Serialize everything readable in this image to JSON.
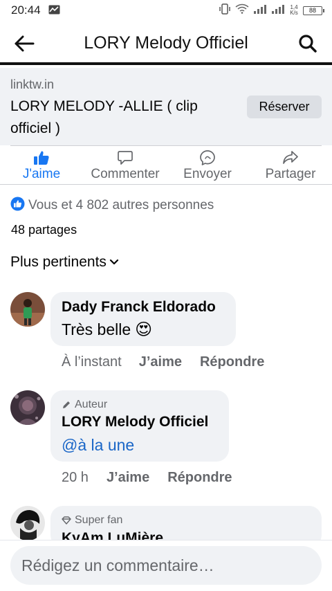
{
  "status_bar": {
    "time": "20:44",
    "net_speed_value": "1,4",
    "net_speed_unit": "K/s",
    "battery_level": "88"
  },
  "app_bar": {
    "title": "LORY Melody Officiel",
    "back_icon": "arrow-left-icon",
    "search_icon": "search-icon"
  },
  "link_card": {
    "domain": "linktw.in",
    "title": "LORY MELODY -ALLIE ( clip officiel )",
    "cta_label": "Réserver"
  },
  "actions": [
    {
      "label": "J'aime",
      "icon": "thumbs-up-icon",
      "active": true
    },
    {
      "label": "Commenter",
      "icon": "comment-icon",
      "active": false
    },
    {
      "label": "Envoyer",
      "icon": "messenger-icon",
      "active": false
    },
    {
      "label": "Partager",
      "icon": "share-icon",
      "active": false
    }
  ],
  "reactions": {
    "summary": "Vous et 4 802 autres personnes",
    "shares": "48 partages"
  },
  "sort": {
    "label": "Plus pertinents"
  },
  "comments": [
    {
      "author": "Dady Franck Eldorado",
      "text": "Très belle",
      "emoji": "😍",
      "time": "À l’instant",
      "like_label": "J’aime",
      "reply_label": "Répondre"
    },
    {
      "badge": "Auteur",
      "author": "LORY Melody Officiel",
      "text": "@à la une",
      "time": "20 h",
      "like_label": "J’aime",
      "reply_label": "Répondre"
    },
    {
      "badge": "Super fan",
      "author": "KyAm LuMière"
    }
  ],
  "composer": {
    "placeholder": "Rédigez un commentaire…"
  },
  "colors": {
    "accent": "#1877f2",
    "secondary_text": "#65676b",
    "bubble": "#f0f2f5",
    "mention": "#1a66c7"
  }
}
